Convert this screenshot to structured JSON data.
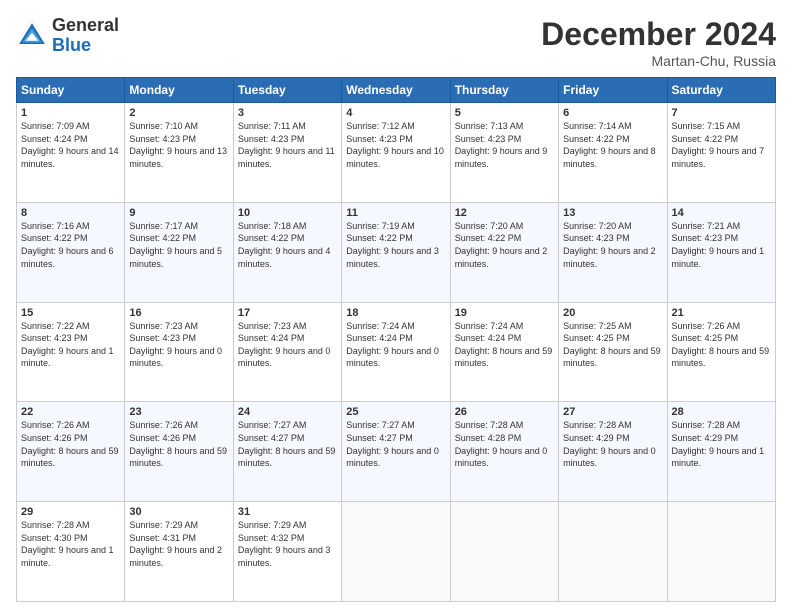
{
  "header": {
    "logo_general": "General",
    "logo_blue": "Blue",
    "month_title": "December 2024",
    "location": "Martan-Chu, Russia"
  },
  "weekdays": [
    "Sunday",
    "Monday",
    "Tuesday",
    "Wednesday",
    "Thursday",
    "Friday",
    "Saturday"
  ],
  "weeks": [
    [
      {
        "day": "1",
        "sunrise": "Sunrise: 7:09 AM",
        "sunset": "Sunset: 4:24 PM",
        "daylight": "Daylight: 9 hours and 14 minutes."
      },
      {
        "day": "2",
        "sunrise": "Sunrise: 7:10 AM",
        "sunset": "Sunset: 4:23 PM",
        "daylight": "Daylight: 9 hours and 13 minutes."
      },
      {
        "day": "3",
        "sunrise": "Sunrise: 7:11 AM",
        "sunset": "Sunset: 4:23 PM",
        "daylight": "Daylight: 9 hours and 11 minutes."
      },
      {
        "day": "4",
        "sunrise": "Sunrise: 7:12 AM",
        "sunset": "Sunset: 4:23 PM",
        "daylight": "Daylight: 9 hours and 10 minutes."
      },
      {
        "day": "5",
        "sunrise": "Sunrise: 7:13 AM",
        "sunset": "Sunset: 4:23 PM",
        "daylight": "Daylight: 9 hours and 9 minutes."
      },
      {
        "day": "6",
        "sunrise": "Sunrise: 7:14 AM",
        "sunset": "Sunset: 4:22 PM",
        "daylight": "Daylight: 9 hours and 8 minutes."
      },
      {
        "day": "7",
        "sunrise": "Sunrise: 7:15 AM",
        "sunset": "Sunset: 4:22 PM",
        "daylight": "Daylight: 9 hours and 7 minutes."
      }
    ],
    [
      {
        "day": "8",
        "sunrise": "Sunrise: 7:16 AM",
        "sunset": "Sunset: 4:22 PM",
        "daylight": "Daylight: 9 hours and 6 minutes."
      },
      {
        "day": "9",
        "sunrise": "Sunrise: 7:17 AM",
        "sunset": "Sunset: 4:22 PM",
        "daylight": "Daylight: 9 hours and 5 minutes."
      },
      {
        "day": "10",
        "sunrise": "Sunrise: 7:18 AM",
        "sunset": "Sunset: 4:22 PM",
        "daylight": "Daylight: 9 hours and 4 minutes."
      },
      {
        "day": "11",
        "sunrise": "Sunrise: 7:19 AM",
        "sunset": "Sunset: 4:22 PM",
        "daylight": "Daylight: 9 hours and 3 minutes."
      },
      {
        "day": "12",
        "sunrise": "Sunrise: 7:20 AM",
        "sunset": "Sunset: 4:22 PM",
        "daylight": "Daylight: 9 hours and 2 minutes."
      },
      {
        "day": "13",
        "sunrise": "Sunrise: 7:20 AM",
        "sunset": "Sunset: 4:23 PM",
        "daylight": "Daylight: 9 hours and 2 minutes."
      },
      {
        "day": "14",
        "sunrise": "Sunrise: 7:21 AM",
        "sunset": "Sunset: 4:23 PM",
        "daylight": "Daylight: 9 hours and 1 minute."
      }
    ],
    [
      {
        "day": "15",
        "sunrise": "Sunrise: 7:22 AM",
        "sunset": "Sunset: 4:23 PM",
        "daylight": "Daylight: 9 hours and 1 minute."
      },
      {
        "day": "16",
        "sunrise": "Sunrise: 7:23 AM",
        "sunset": "Sunset: 4:23 PM",
        "daylight": "Daylight: 9 hours and 0 minutes."
      },
      {
        "day": "17",
        "sunrise": "Sunrise: 7:23 AM",
        "sunset": "Sunset: 4:24 PM",
        "daylight": "Daylight: 9 hours and 0 minutes."
      },
      {
        "day": "18",
        "sunrise": "Sunrise: 7:24 AM",
        "sunset": "Sunset: 4:24 PM",
        "daylight": "Daylight: 9 hours and 0 minutes."
      },
      {
        "day": "19",
        "sunrise": "Sunrise: 7:24 AM",
        "sunset": "Sunset: 4:24 PM",
        "daylight": "Daylight: 8 hours and 59 minutes."
      },
      {
        "day": "20",
        "sunrise": "Sunrise: 7:25 AM",
        "sunset": "Sunset: 4:25 PM",
        "daylight": "Daylight: 8 hours and 59 minutes."
      },
      {
        "day": "21",
        "sunrise": "Sunrise: 7:26 AM",
        "sunset": "Sunset: 4:25 PM",
        "daylight": "Daylight: 8 hours and 59 minutes."
      }
    ],
    [
      {
        "day": "22",
        "sunrise": "Sunrise: 7:26 AM",
        "sunset": "Sunset: 4:26 PM",
        "daylight": "Daylight: 8 hours and 59 minutes."
      },
      {
        "day": "23",
        "sunrise": "Sunrise: 7:26 AM",
        "sunset": "Sunset: 4:26 PM",
        "daylight": "Daylight: 8 hours and 59 minutes."
      },
      {
        "day": "24",
        "sunrise": "Sunrise: 7:27 AM",
        "sunset": "Sunset: 4:27 PM",
        "daylight": "Daylight: 8 hours and 59 minutes."
      },
      {
        "day": "25",
        "sunrise": "Sunrise: 7:27 AM",
        "sunset": "Sunset: 4:27 PM",
        "daylight": "Daylight: 9 hours and 0 minutes."
      },
      {
        "day": "26",
        "sunrise": "Sunrise: 7:28 AM",
        "sunset": "Sunset: 4:28 PM",
        "daylight": "Daylight: 9 hours and 0 minutes."
      },
      {
        "day": "27",
        "sunrise": "Sunrise: 7:28 AM",
        "sunset": "Sunset: 4:29 PM",
        "daylight": "Daylight: 9 hours and 0 minutes."
      },
      {
        "day": "28",
        "sunrise": "Sunrise: 7:28 AM",
        "sunset": "Sunset: 4:29 PM",
        "daylight": "Daylight: 9 hours and 1 minute."
      }
    ],
    [
      {
        "day": "29",
        "sunrise": "Sunrise: 7:28 AM",
        "sunset": "Sunset: 4:30 PM",
        "daylight": "Daylight: 9 hours and 1 minute."
      },
      {
        "day": "30",
        "sunrise": "Sunrise: 7:29 AM",
        "sunset": "Sunset: 4:31 PM",
        "daylight": "Daylight: 9 hours and 2 minutes."
      },
      {
        "day": "31",
        "sunrise": "Sunrise: 7:29 AM",
        "sunset": "Sunset: 4:32 PM",
        "daylight": "Daylight: 9 hours and 3 minutes."
      },
      null,
      null,
      null,
      null
    ]
  ]
}
